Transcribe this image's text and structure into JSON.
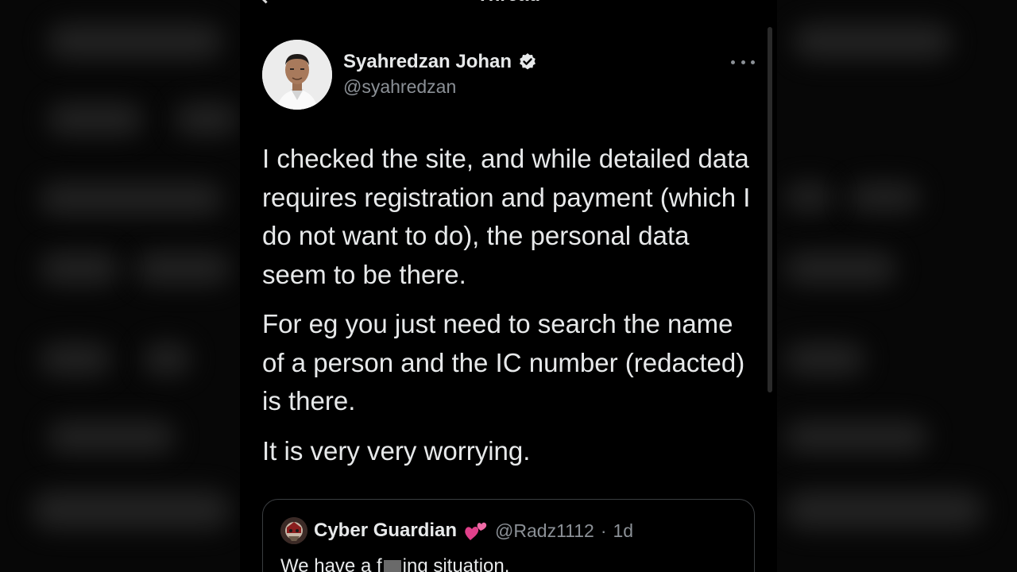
{
  "header": {
    "title": "Thread"
  },
  "tweet": {
    "author_name": "Syahredzan Johan",
    "author_handle": "@syahredzan",
    "paragraphs": [
      "I checked the site, and while detailed data requires registration and payment (which I do not want to do), the personal data seem to be there.",
      "For eg you just need to search the name of a person and the IC number (redacted) is there.",
      "It is very very worrying."
    ]
  },
  "quote": {
    "author_name": "Cyber Guardian",
    "emoji": "💕",
    "author_handle": "@Radz1112",
    "separator": "·",
    "time": "1d",
    "text_before": "We have a f",
    "text_after": "ing situation."
  },
  "icons": {
    "back": "arrow-left-icon",
    "verified": "verified-badge-icon",
    "more": "more-horizontal-icon",
    "heart": "two-hearts-emoji-icon"
  },
  "colors": {
    "background": "#000000",
    "text_primary": "#e7e9ea",
    "text_secondary": "#8b9096",
    "border": "#3a3d40"
  }
}
